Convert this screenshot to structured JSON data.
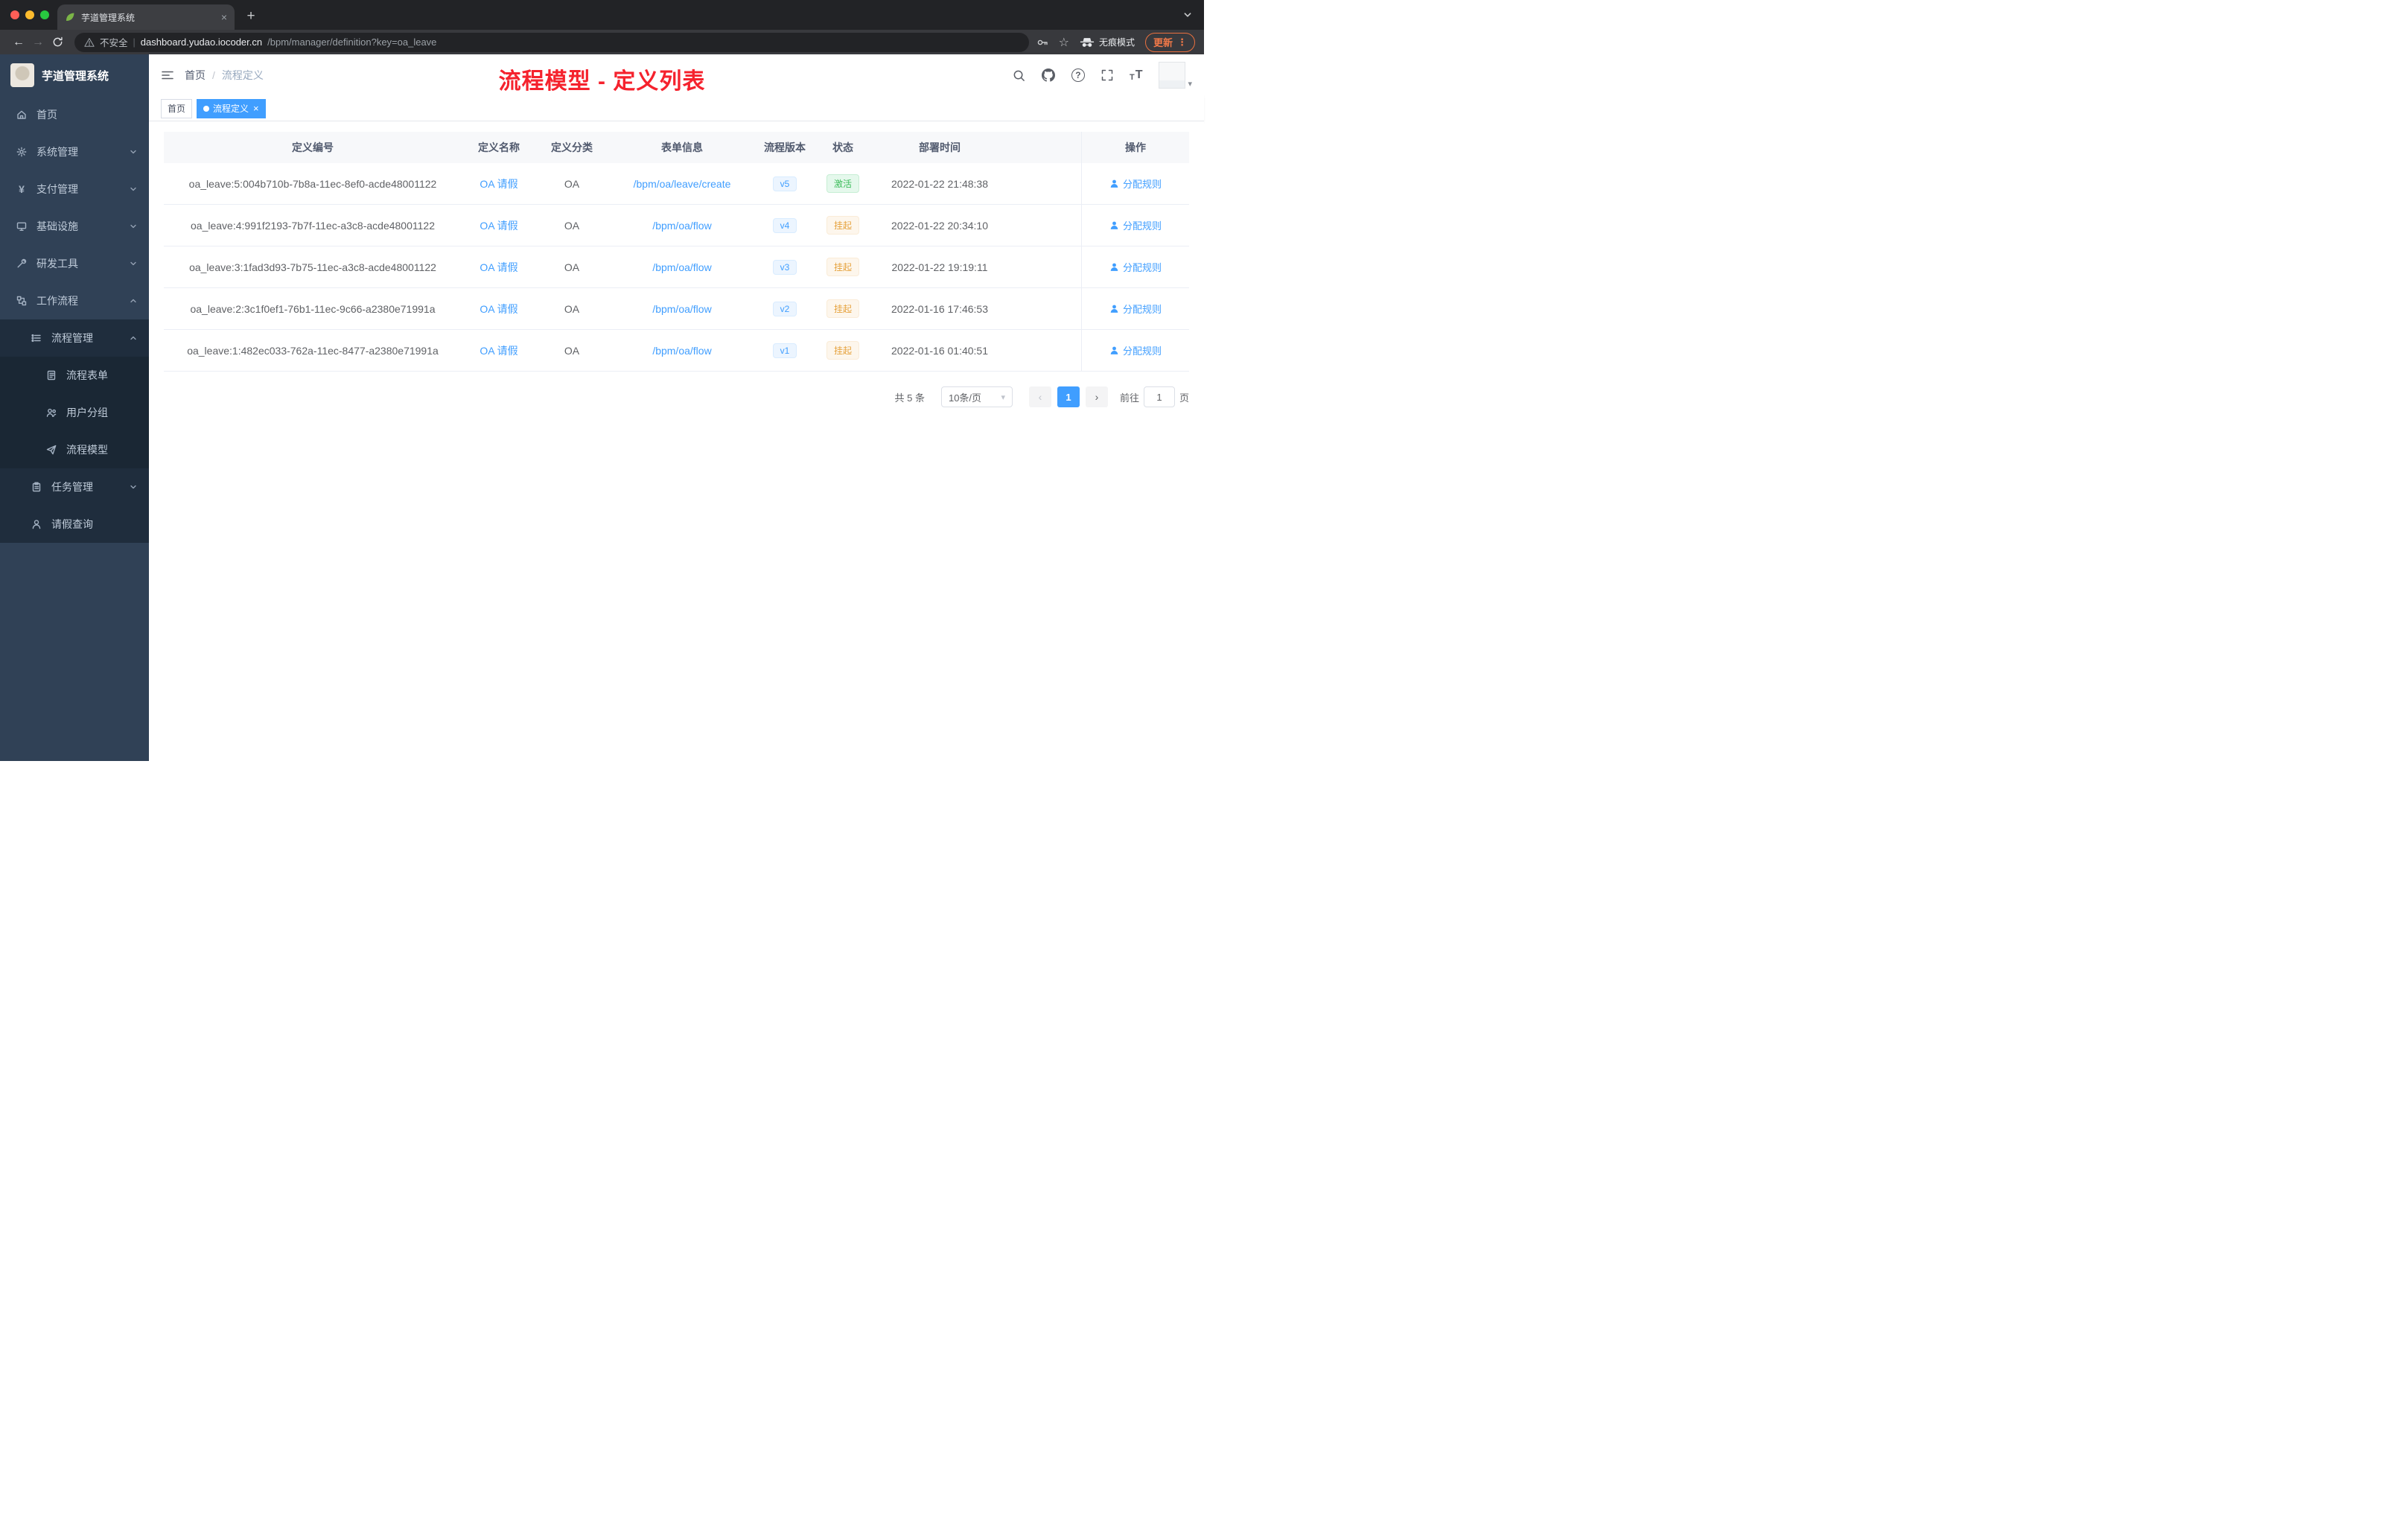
{
  "colors": {
    "accent": "#409eff",
    "annotation_red": "#f5222d",
    "sidebar_bg": "#304156",
    "sidebar_nested_bg": "#1f2d3d",
    "success_text": "#3dbd5b",
    "success_bg": "#e5f8ec",
    "warning_text": "#e6a23c",
    "warning_bg": "#fdf6ec",
    "version_text": "#409eff",
    "version_bg": "#ecf5ff",
    "update_orange": "#e9703e",
    "tab_active_blue": "#409eff"
  },
  "browser": {
    "tab_title": "芋道管理系统",
    "security_label": "不安全",
    "url_domain": "dashboard.yudao.iocoder.cn",
    "url_path": "/bpm/manager/definition?key=oa_leave",
    "incognito_label": "无痕模式",
    "update_label": "更新"
  },
  "icons": {
    "close": "×",
    "new_tab": "+",
    "back": "←",
    "forward": "→",
    "kebab": "⋮",
    "star": "☆",
    "question": "?",
    "yen": "¥",
    "select_caret": "▾",
    "avatar_caret": "▾",
    "breadcrumb_sep": "/",
    "url_sep": "|",
    "prev": "‹",
    "next": "›",
    "text_small": "T",
    "text_large": "T"
  },
  "sidebar": {
    "logo_title": "芋道管理系统",
    "items": [
      {
        "label": "首页"
      },
      {
        "label": "系统管理"
      },
      {
        "label": "支付管理"
      },
      {
        "label": "基础设施"
      },
      {
        "label": "研发工具"
      },
      {
        "label": "工作流程"
      },
      {
        "label": "流程管理"
      },
      {
        "label": "流程表单"
      },
      {
        "label": "用户分组"
      },
      {
        "label": "流程模型"
      },
      {
        "label": "任务管理"
      },
      {
        "label": "请假查询"
      }
    ]
  },
  "header": {
    "breadcrumb_home": "首页",
    "breadcrumb_current": "流程定义",
    "annotation": "流程模型 - 定义列表"
  },
  "tags": {
    "home": "首页",
    "current": "流程定义"
  },
  "table": {
    "columns": [
      "定义编号",
      "定义名称",
      "定义分类",
      "表单信息",
      "流程版本",
      "状态",
      "部署时间",
      "操作"
    ],
    "rows": [
      {
        "id": "oa_leave:5:004b710b-7b8a-11ec-8ef0-acde48001122",
        "name": "OA 请假",
        "category": "OA",
        "form": "/bpm/oa/leave/create",
        "version": "v5",
        "status": "激活",
        "time": "2022-01-22 21:48:38",
        "action": "分配规则"
      },
      {
        "id": "oa_leave:4:991f2193-7b7f-11ec-a3c8-acde48001122",
        "name": "OA 请假",
        "category": "OA",
        "form": "/bpm/oa/flow",
        "version": "v4",
        "status": "挂起",
        "time": "2022-01-22 20:34:10",
        "action": "分配规则"
      },
      {
        "id": "oa_leave:3:1fad3d93-7b75-11ec-a3c8-acde48001122",
        "name": "OA 请假",
        "category": "OA",
        "form": "/bpm/oa/flow",
        "version": "v3",
        "status": "挂起",
        "time": "2022-01-22 19:19:11",
        "action": "分配规则"
      },
      {
        "id": "oa_leave:2:3c1f0ef1-76b1-11ec-9c66-a2380e71991a",
        "name": "OA 请假",
        "category": "OA",
        "form": "/bpm/oa/flow",
        "version": "v2",
        "status": "挂起",
        "time": "2022-01-16 17:46:53",
        "action": "分配规则"
      },
      {
        "id": "oa_leave:1:482ec033-762a-11ec-8477-a2380e71991a",
        "name": "OA 请假",
        "category": "OA",
        "form": "/bpm/oa/flow",
        "version": "v1",
        "status": "挂起",
        "time": "2022-01-16 01:40:51",
        "action": "分配规则"
      }
    ]
  },
  "pagination": {
    "total": "共 5 条",
    "page_size": "10条/页",
    "page": "1",
    "goto_label": "前往",
    "goto_value": "1",
    "page_suffix": "页"
  }
}
